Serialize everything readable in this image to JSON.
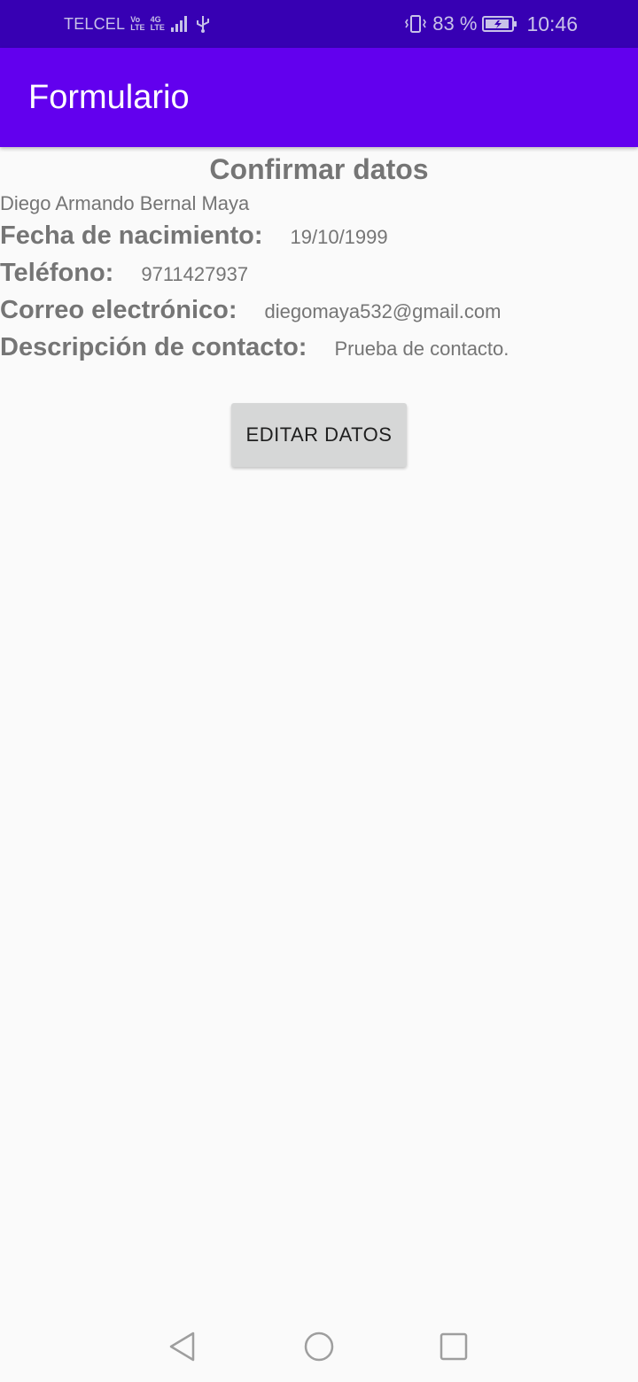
{
  "status_bar": {
    "carrier": "TELCEL",
    "volte_top": "Vo",
    "volte_bottom": "LTE",
    "network_top": "4G",
    "network_bottom": "LTE",
    "battery_percent": "83 %",
    "time": "10:46",
    "icons": [
      "signal-icon",
      "usb-icon",
      "vibrate-icon",
      "battery-charging-icon"
    ]
  },
  "app_bar": {
    "title": "Formulario"
  },
  "content": {
    "heading": "Confirmar datos",
    "full_name": "Diego Armando Bernal Maya",
    "fields": [
      {
        "label": "Fecha de nacimiento:",
        "value": "19/10/1999"
      },
      {
        "label": "Teléfono:",
        "value": "9711427937"
      },
      {
        "label": "Correo electrónico:",
        "value": "diegomaya532@gmail.com"
      },
      {
        "label": "Descripción de contacto:",
        "value": "Prueba de contacto."
      }
    ],
    "edit_button_label": "EDITAR DATOS"
  },
  "nav_bar": {
    "icons": [
      "back-icon",
      "home-icon",
      "recents-icon"
    ]
  },
  "colors": {
    "status_bar": "#3700b3",
    "app_bar": "#6200ee",
    "text_gray": "#757575",
    "button_bg": "#d6d7d7"
  }
}
